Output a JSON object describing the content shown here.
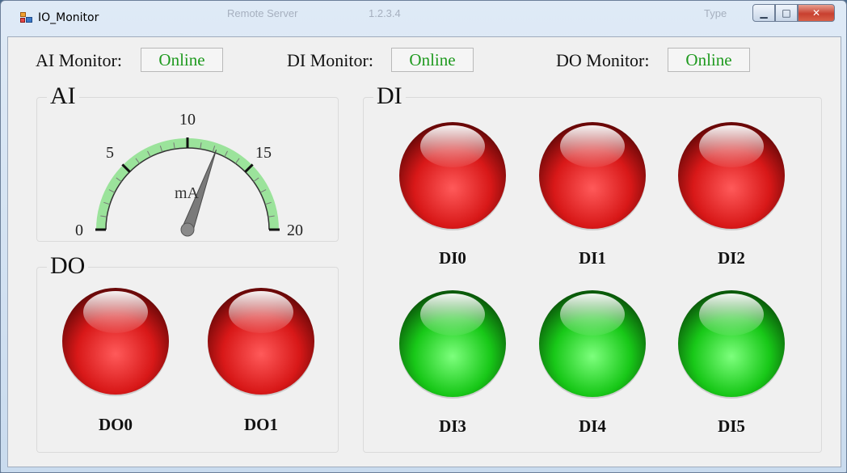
{
  "window": {
    "title": "IO_Monitor",
    "ghost_texts": [
      "Remote Server",
      "1.2.3.4",
      "Type"
    ]
  },
  "monitors": [
    {
      "label": "AI Monitor:",
      "status": "Online"
    },
    {
      "label": "DI Monitor:",
      "status": "Online"
    },
    {
      "label": "DO Monitor:",
      "status": "Online"
    }
  ],
  "ai": {
    "title": "AI",
    "gauge": {
      "min": 0,
      "max": 20,
      "value": 12.2,
      "unit": "mA",
      "ticks": [
        "0",
        "5",
        "10",
        "15",
        "20"
      ]
    }
  },
  "do": {
    "title": "DO",
    "leds": [
      {
        "label": "DO0",
        "state": "red"
      },
      {
        "label": "DO1",
        "state": "red"
      }
    ]
  },
  "di": {
    "title": "DI",
    "leds": [
      {
        "label": "DI0",
        "state": "red"
      },
      {
        "label": "DI1",
        "state": "red"
      },
      {
        "label": "DI2",
        "state": "red"
      },
      {
        "label": "DI3",
        "state": "green"
      },
      {
        "label": "DI4",
        "state": "green"
      },
      {
        "label": "DI5",
        "state": "green"
      }
    ]
  },
  "colors": {
    "online_text": "#1f9a1f",
    "led_red": "#e02020",
    "led_green": "#20d020",
    "gauge_band": "#9be39b"
  }
}
